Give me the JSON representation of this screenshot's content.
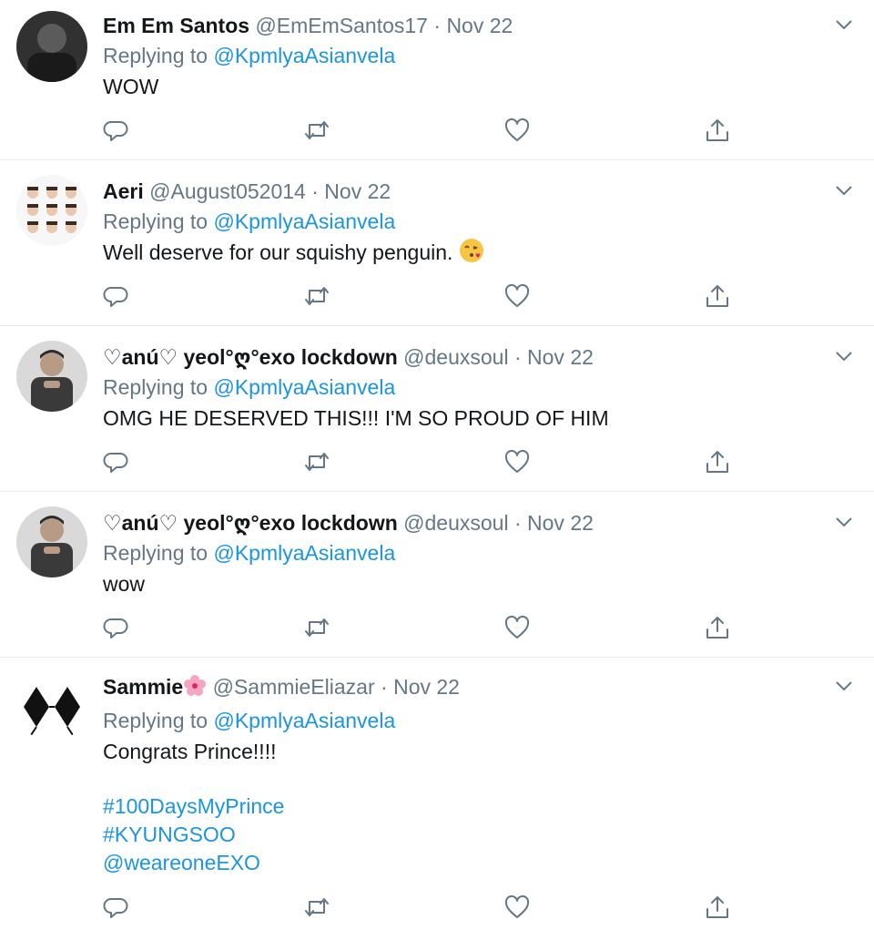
{
  "reply_prefix": "Replying to",
  "tweets": [
    {
      "name": "Em Em Santos",
      "handle": "@EmEmSantos17",
      "sep": "·",
      "date": "Nov 22",
      "replying_to": "@KpmlyaAsianvela",
      "text": "WOW"
    },
    {
      "name": "Aeri",
      "handle": "@August052014",
      "sep": "·",
      "date": "Nov 22",
      "replying_to": "@KpmlyaAsianvela",
      "text": "Well deserve for our squishy penguin.",
      "emoji": "face-blowing-kiss"
    },
    {
      "name": "♡anú♡ yeol°ღ°exo lockdown",
      "handle": "@deuxsoul",
      "sep": "·",
      "date": "Nov 22",
      "replying_to": "@KpmlyaAsianvela",
      "text": "OMG HE DESERVED THIS!!! I'M SO PROUD OF HIM"
    },
    {
      "name": "♡anú♡ yeol°ღ°exo lockdown",
      "handle": "@deuxsoul",
      "sep": "·",
      "date": "Nov 22",
      "replying_to": "@KpmlyaAsianvela",
      "text": "wow"
    },
    {
      "name": "Sammie",
      "name_emoji": "cherry-blossom",
      "handle": "@SammieEliazar",
      "sep": "·",
      "date": "Nov 22",
      "replying_to": "@KpmlyaAsianvela",
      "text": "Congrats Prince!!!!",
      "links": [
        "#100DaysMyPrince",
        "#KYUNGSOO",
        "@weareoneEXO"
      ]
    }
  ],
  "colors": {
    "link": "#1b95e0",
    "muted": "#657786",
    "text": "#14171a",
    "divider": "#e6ecf0"
  }
}
